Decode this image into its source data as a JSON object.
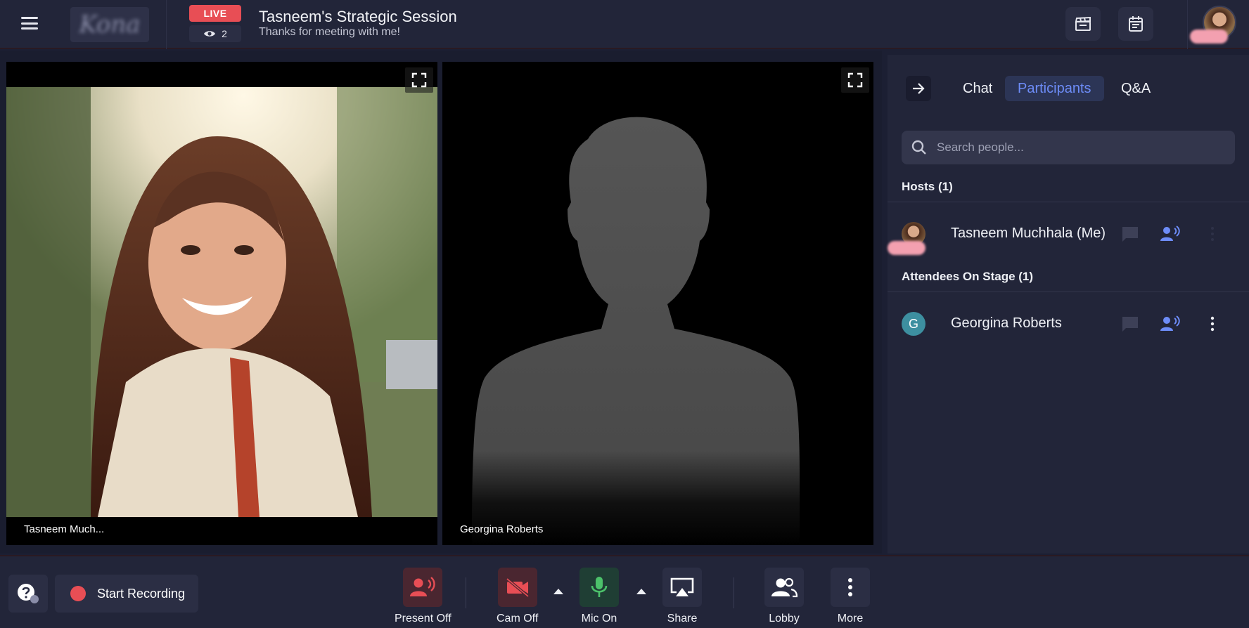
{
  "header": {
    "logo_text": "Kona",
    "live_label": "LIVE",
    "viewer_count": "2",
    "session_title": "Tasneem's Strategic Session",
    "session_subtitle": "Thanks for meeting with me!",
    "icons": [
      "menu-icon",
      "eye-icon",
      "clapperboard-icon",
      "calendar-icon"
    ]
  },
  "stage": {
    "tiles": [
      {
        "name": "Tasneem Much...",
        "video": "on"
      },
      {
        "name": "Georgina Roberts",
        "video": "off"
      }
    ]
  },
  "panel": {
    "tabs": [
      {
        "label": "Chat",
        "active": false
      },
      {
        "label": "Participants",
        "active": true
      },
      {
        "label": "Q&A",
        "active": false
      }
    ],
    "search_placeholder": "Search people...",
    "sections": {
      "hosts": {
        "label": "Hosts (1)",
        "people": [
          {
            "name": "Tasneem Muchhala (Me)"
          }
        ]
      },
      "attendees": {
        "label": "Attendees On Stage (1)",
        "people": [
          {
            "name": "Georgina Roberts",
            "initial": "G"
          }
        ]
      }
    }
  },
  "toolbar": {
    "start_recording": "Start Recording",
    "controls": [
      {
        "label": "Present Off",
        "state": "off",
        "color": "#e84e55"
      },
      {
        "label": "Cam Off",
        "state": "off",
        "color": "#e84e55"
      },
      {
        "label": "Mic On",
        "state": "on",
        "color": "#4cc16a"
      },
      {
        "label": "Share"
      },
      {
        "label": "Lobby"
      },
      {
        "label": "More"
      }
    ]
  },
  "colors": {
    "accent": "#6d8cf7",
    "live": "#e84e55",
    "background": "#1c1f33",
    "panel": "#222539"
  }
}
